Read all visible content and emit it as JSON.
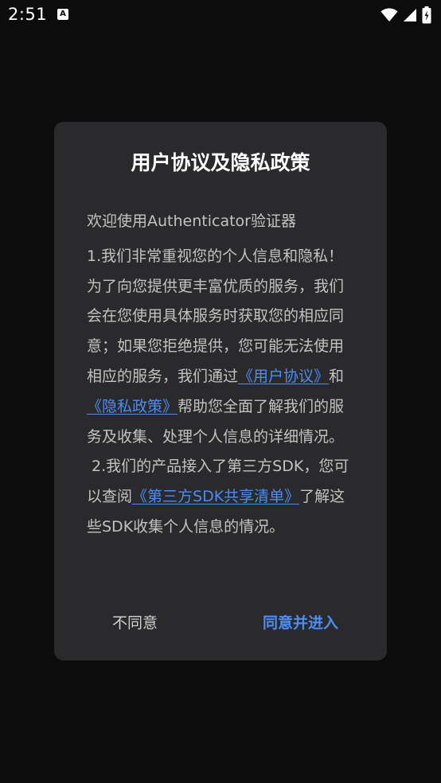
{
  "status_bar": {
    "time": "2:51",
    "app_icon": "A",
    "icons": [
      "wifi-icon",
      "signal-icon",
      "battery-icon"
    ]
  },
  "dialog": {
    "title": "用户协议及隐私政策",
    "greeting": "欢迎使用Authenticator验证器",
    "p1_prefix": "1.我们非常重视您的个人信息和隐私！为了向您提供更丰富优质的服务，我们会在您使用具体服务时获取您的相应同意；如果您拒绝提供，您可能无法使用相应的服务，我们通过",
    "link_user_agreement": "《用户协议》",
    "p1_and": "和",
    "link_privacy_policy": "《隐私政策》",
    "p1_suffix": "帮助您全面了解我们的服务及收集、处理个人信息的详细情况。",
    "p2_prefix": " 2.我们的产品接入了第三方SDK，您可以查阅",
    "link_sdk_list": "《第三方SDK共享清单》",
    "p2_suffix": "了解这些SDK收集个人信息的情况。",
    "disagree_label": "不同意",
    "agree_label": "同意并进入"
  },
  "colors": {
    "background": "#0c0c0d",
    "dialog": "#2a2a2c",
    "link": "#4b8cf5",
    "body_text": "#c2c2c2"
  }
}
